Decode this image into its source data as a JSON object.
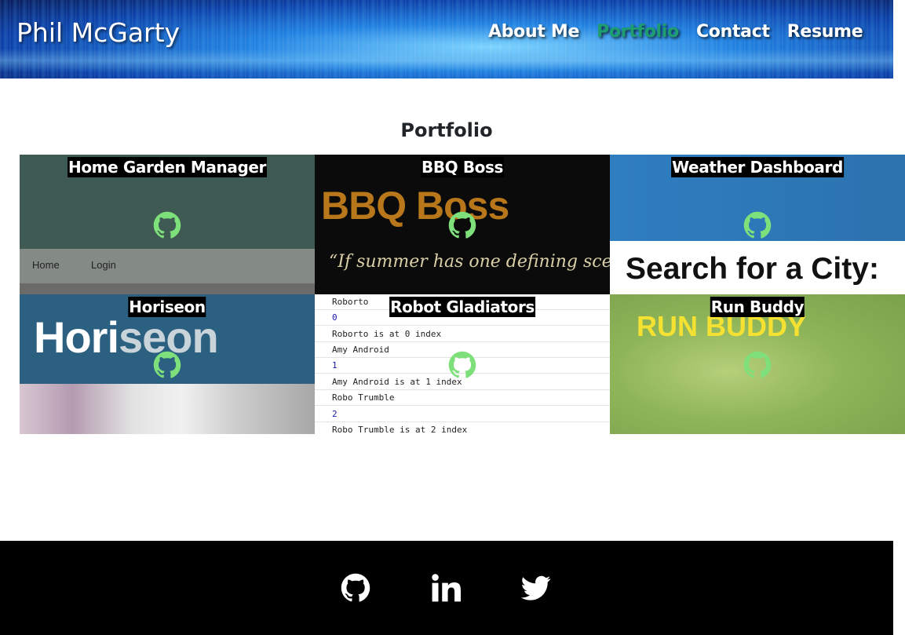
{
  "header": {
    "brand": "Phil McGarty",
    "nav": [
      {
        "label": "About Me",
        "active": false
      },
      {
        "label": "Portfolio",
        "active": true
      },
      {
        "label": "Contact",
        "active": false
      },
      {
        "label": "Resume",
        "active": false
      }
    ]
  },
  "portfolio": {
    "title": "Portfolio",
    "projects": [
      {
        "title": "Home Garden Manager",
        "icon": "github-icon",
        "preview": {
          "nav_items": [
            "Home",
            "Login"
          ]
        }
      },
      {
        "title": "BBQ Boss",
        "icon": "github-icon",
        "preview": {
          "heading": "BBQ Boss",
          "quote": "“If summer has one defining scent, it’d be th"
        }
      },
      {
        "title": "Weather Dashboard",
        "icon": "github-icon",
        "preview": {
          "heading": "Search for a City:"
        }
      },
      {
        "title": "Horiseon",
        "icon": "github-icon",
        "preview": {
          "logo_main": "Hori",
          "logo_accent": "seon"
        }
      },
      {
        "title": "Robot Gladiators",
        "icon": "github-icon",
        "preview": {
          "lines": [
            {
              "text": "Roborto",
              "kind": "text"
            },
            {
              "text": "0",
              "kind": "num"
            },
            {
              "text": "Roborto is at 0 index",
              "kind": "text"
            },
            {
              "text": "Amy Android",
              "kind": "text"
            },
            {
              "text": "1",
              "kind": "num"
            },
            {
              "text": "Amy Android is at 1 index",
              "kind": "text"
            },
            {
              "text": "Robo Trumble",
              "kind": "text"
            },
            {
              "text": "2",
              "kind": "num"
            },
            {
              "text": "Robo Trumble is at 2 index",
              "kind": "text"
            }
          ]
        }
      },
      {
        "title": "Run Buddy",
        "icon": "github-icon",
        "preview": {
          "heading": "RUN BUDDY"
        }
      }
    ]
  },
  "footer": {
    "links": [
      {
        "icon": "github-icon"
      },
      {
        "icon": "linkedin-icon"
      },
      {
        "icon": "twitter-icon"
      }
    ]
  },
  "colors": {
    "nav_active": "#1e9e6e",
    "card_icon": "#7ee07a",
    "footer_bg": "#000000"
  }
}
